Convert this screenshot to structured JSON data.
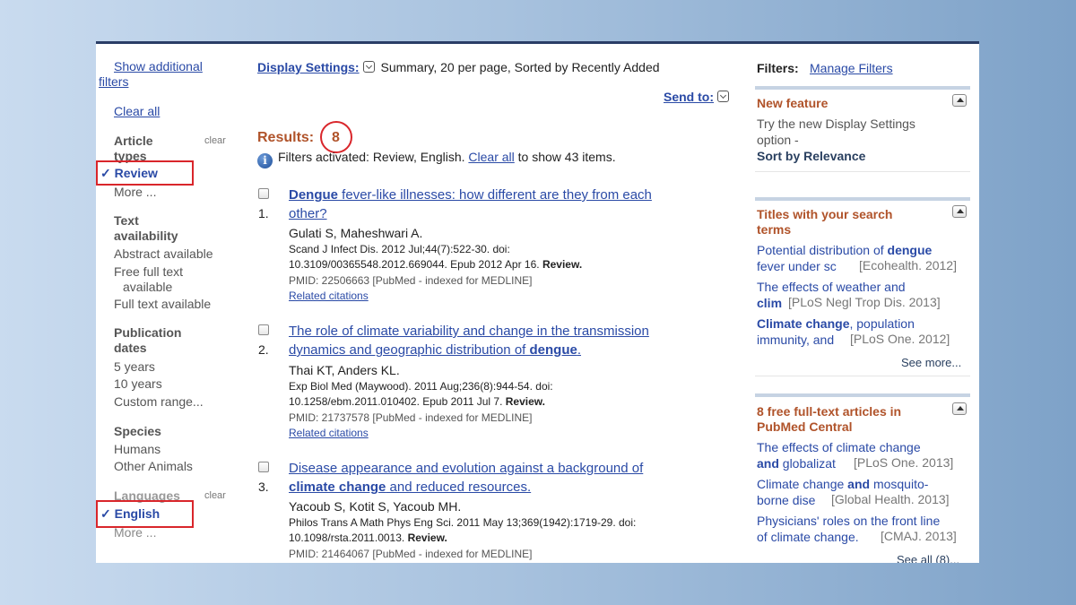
{
  "left": {
    "show_filters": "Show additional",
    "show_filters_2": "filters",
    "clear_all": "Clear all",
    "article_types": {
      "head": "Article",
      "head2": "types",
      "clear": "clear",
      "selected": "Review",
      "more": "More ..."
    },
    "text_availability": {
      "head": "Text",
      "head2": "availability",
      "items": [
        "Abstract available",
        "Free full text",
        "available",
        "Full text available"
      ]
    },
    "publication_dates": {
      "head": "Publication",
      "head2": "dates",
      "items": [
        "5 years",
        "10 years",
        "Custom range..."
      ]
    },
    "species": {
      "head": "Species",
      "items": [
        "Humans",
        "Other Animals"
      ]
    },
    "languages": {
      "head": "Languages",
      "clear": "clear",
      "selected": "English",
      "more": "More ..."
    }
  },
  "mid": {
    "display_settings_label": "Display Settings:",
    "display_settings_value": "Summary, 20 per page, Sorted by Recently Added",
    "send_to": "Send to:",
    "results_label": "Results:",
    "results_count": "8",
    "filters_msg": "Filters activated: Review, English.",
    "filters_clear": "Clear all",
    "filters_msg2": "to show 43 items.",
    "results": [
      {
        "num": "1.",
        "title_bold": "Dengue",
        "title_line1_rest": " fever-like illnesses: how different are they from each",
        "title_line2": "other?",
        "authors": "Gulati S, Maheshwari A.",
        "cite1": "Scand J Infect Dis. 2012 Jul;44(7):522-30. doi:",
        "cite2": "10.3109/00365548.2012.669044. Epub 2012 Apr 16.",
        "review": "Review.",
        "pmid": "PMID: 22506663 [PubMed - indexed for MEDLINE]",
        "related": "Related citations"
      },
      {
        "num": "2.",
        "title_line1": "The role of climate variability and change in the transmission",
        "title_line2": "dynamics and geographic distribution of ",
        "title_bold": "dengue",
        "title_end": ".",
        "authors": "Thai KT, Anders KL.",
        "cite1": "Exp Biol Med (Maywood). 2011 Aug;236(8):944-54. doi:",
        "cite2": "10.1258/ebm.2011.010402. Epub 2011 Jul 7.",
        "review": "Review.",
        "pmid": "PMID: 21737578 [PubMed - indexed for MEDLINE]",
        "related": "Related citations"
      },
      {
        "num": "3.",
        "title_line1": "Disease appearance and evolution against a background of",
        "title_bold": "climate change",
        "title_line2_rest": " and reduced resources.",
        "authors": "Yacoub S, Kotit S, Yacoub MH.",
        "cite1": "Philos Trans A Math Phys Eng Sci. 2011 May 13;369(1942):1719-29. doi:",
        "cite2": "10.1098/rsta.2011.0013.",
        "review": "Review.",
        "pmid": "PMID: 21464067 [PubMed - indexed for MEDLINE]"
      }
    ]
  },
  "right": {
    "filters_label": "Filters:",
    "manage_filters": "Manage Filters",
    "new_feature": {
      "head": "New feature",
      "line1": "Try the new Display Settings",
      "line2": "option -",
      "line3": "Sort by Relevance"
    },
    "titles": {
      "head": "Titles with your search",
      "head2": "terms",
      "items": [
        {
          "a": "Potential distribution of ",
          "b": "dengue",
          "c": "",
          "l2": "fever under sc",
          "src": "[Ecohealth. 2012]"
        },
        {
          "a": "The effects of weather and",
          "b": "",
          "c": "",
          "l2b": "clim",
          "src": "[PLoS Negl Trop Dis. 2013]"
        },
        {
          "b": "Climate change",
          "a": ", population",
          "l2": "immunity, and",
          "src": "[PLoS One. 2012]"
        }
      ],
      "see_more": "See more..."
    },
    "free": {
      "head": "8 free full-text articles in",
      "head2": "PubMed Central",
      "items": [
        {
          "l1": "The effects of climate change",
          "l2b": "and",
          "l2": " globalizat",
          "src": "[PLoS One. 2013]"
        },
        {
          "l1": "Climate change ",
          "l1b": "and",
          "l1c": " mosquito-",
          "l2": "borne dise",
          "src": "[Global Health. 2013]"
        },
        {
          "l1": "Physicians' roles on the front line",
          "l2": "of climate change.",
          "src": "[CMAJ. 2013]"
        }
      ],
      "see_all": "See all (8)..."
    }
  }
}
